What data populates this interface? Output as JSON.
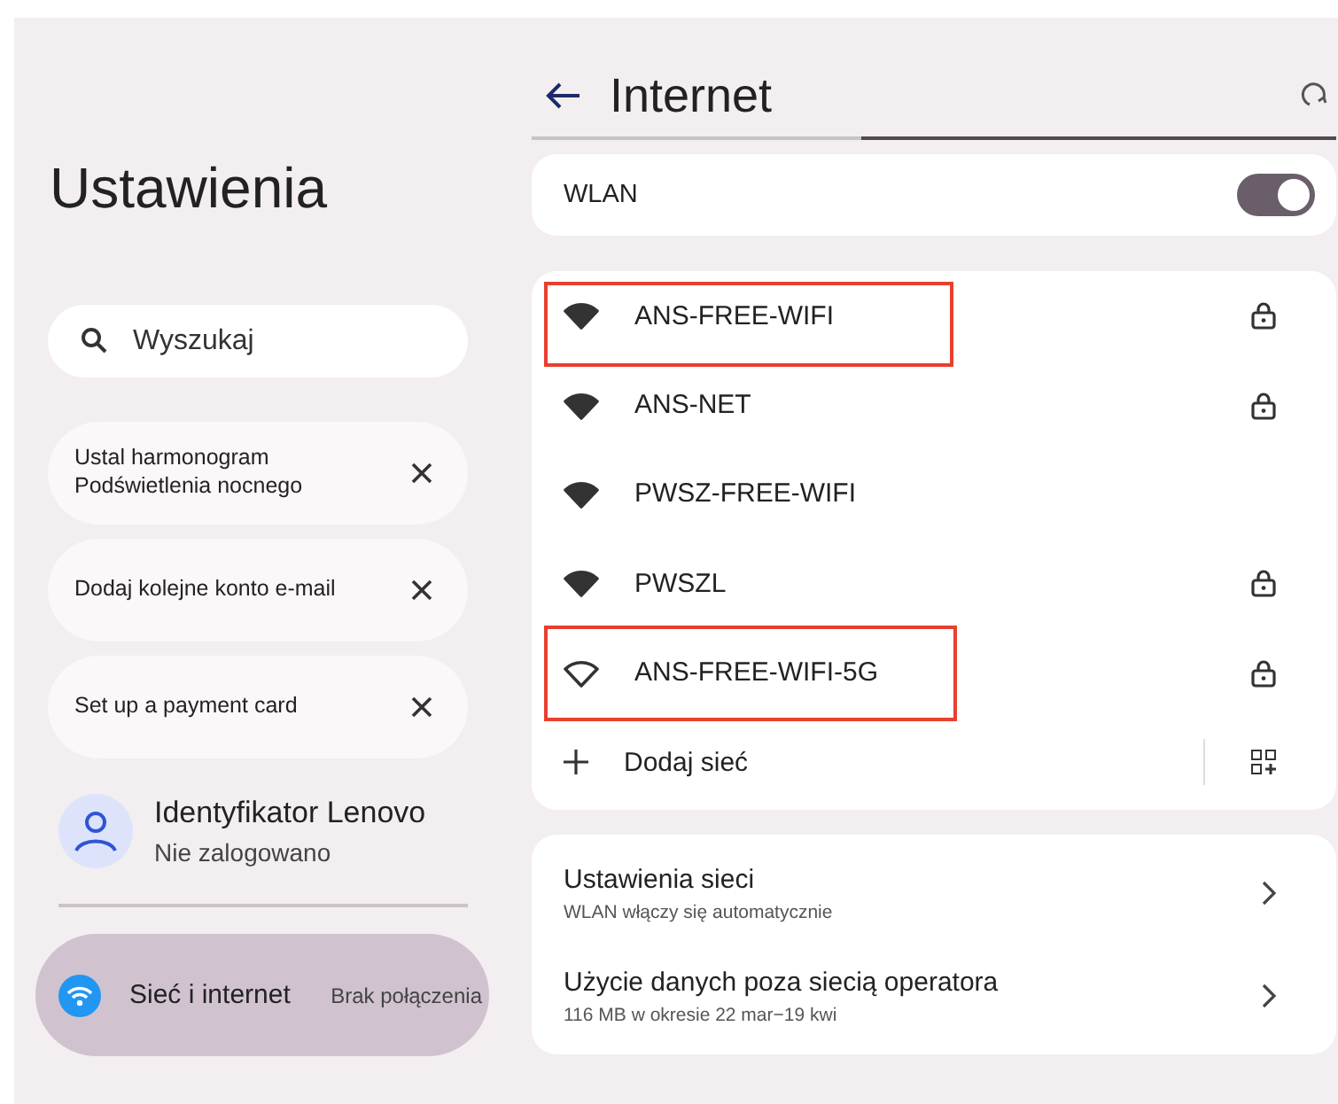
{
  "sidebar": {
    "title": "Ustawienia",
    "search": {
      "placeholder": "Wyszukaj"
    },
    "suggestions": [
      {
        "text": "Ustal harmonogram\nPodświetlenia nocnego"
      },
      {
        "text": "Dodaj kolejne konto e-mail"
      },
      {
        "text": "Set up a payment card"
      }
    ],
    "account": {
      "name": "Identyfikator Lenovo",
      "status": "Nie zalogowano"
    },
    "items": [
      {
        "label": "Sieć i internet",
        "detail": "Brak połączenia",
        "selected": true
      }
    ]
  },
  "page": {
    "title": "Internet",
    "wlan": {
      "label": "WLAN",
      "on": true
    },
    "networks": [
      {
        "name": "ANS-FREE-WIFI",
        "filled": true,
        "locked": true,
        "highlighted": true
      },
      {
        "name": "ANS-NET",
        "filled": true,
        "locked": true,
        "highlighted": false
      },
      {
        "name": "PWSZ-FREE-WIFI",
        "filled": true,
        "locked": false,
        "highlighted": false
      },
      {
        "name": "PWSZL",
        "filled": true,
        "locked": true,
        "highlighted": false
      },
      {
        "name": "ANS-FREE-WIFI-5G",
        "filled": false,
        "locked": true,
        "highlighted": true
      }
    ],
    "add_network": "Dodaj sieć",
    "settings": [
      {
        "title": "Ustawienia sieci",
        "subtitle": "WLAN włączy się automatycznie"
      },
      {
        "title": "Użycie danych poza siecią operatora",
        "subtitle": "116 MB w okresie 22 mar−19 kwi"
      }
    ]
  }
}
